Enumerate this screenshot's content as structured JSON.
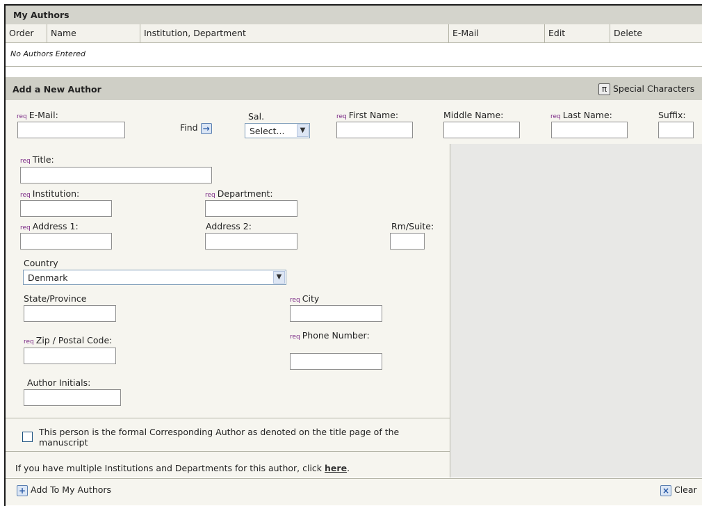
{
  "my_authors": {
    "title": "My Authors",
    "columns": [
      "Order",
      "Name",
      "Institution, Department",
      "E-Mail",
      "Edit",
      "Delete"
    ],
    "empty_text": "No Authors Entered"
  },
  "add_author": {
    "title": "Add a New Author",
    "special_characters": "Special Characters",
    "special_icon": "π",
    "req": "req",
    "email_label": "E-Mail:",
    "find_label": "Find",
    "sal_label": "Sal.",
    "sal_value": "Select...",
    "first_name_label": "First Name:",
    "middle_name_label": "Middle Name:",
    "last_name_label": "Last Name:",
    "suffix_label": "Suffix:",
    "title_label": "Title:",
    "institution_label": "Institution:",
    "department_label": "Department:",
    "address1_label": "Address 1:",
    "address2_label": "Address 2:",
    "rm_suite_label": "Rm/Suite:",
    "country_label": "Country",
    "country_value": "Denmark",
    "state_label": "State/Province",
    "city_label": "City",
    "zip_label": "Zip / Postal Code:",
    "phone_label": "Phone Number:",
    "initials_label": "Author Initials:",
    "corresponding_text": "This person is the formal Corresponding Author as denoted on the title page of the manuscript",
    "multi_inst_text": "If you have multiple Institutions and Departments for this author, click",
    "multi_inst_link": "here",
    "add_button": "Add To My Authors",
    "clear_button": "Clear"
  }
}
